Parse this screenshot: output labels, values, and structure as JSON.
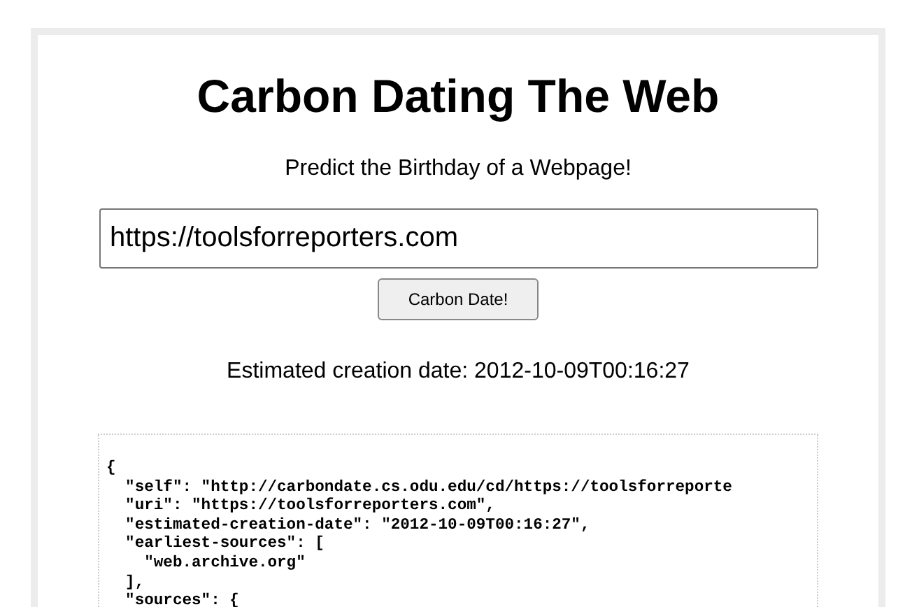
{
  "title": "Carbon Dating The Web",
  "subtitle": "Predict the Birthday of a Webpage!",
  "url_field": {
    "value": "https://toolsforreporters.com"
  },
  "submit_button": "Carbon Date!",
  "result": "Estimated creation date: 2012-10-09T00:16:27",
  "json_output": [
    "{",
    "  \"self\": \"http://carbondate.cs.odu.edu/cd/https://toolsforreporte",
    "  \"uri\": \"https://toolsforreporters.com\",",
    "  \"estimated-creation-date\": \"2012-10-09T00:16:27\",",
    "  \"earliest-sources\": [",
    "    \"web.archive.org\"",
    "  ],",
    "  \"sources\": {"
  ]
}
